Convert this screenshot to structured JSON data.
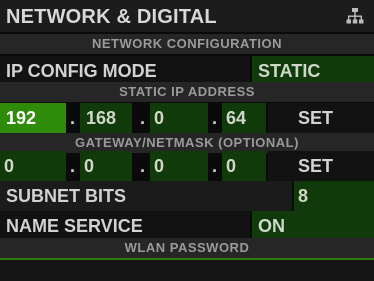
{
  "header": {
    "title": "NETWORK & DIGITAL",
    "icon": "network-icon"
  },
  "sections": {
    "network_config": "NETWORK CONFIGURATION",
    "static_ip": "STATIC IP ADDRESS",
    "gateway": "GATEWAY/NETMASK (OPTIONAL)",
    "wlan": "WLAN PASSWORD"
  },
  "ip_config": {
    "label": "IP CONFIG MODE",
    "value": "STATIC"
  },
  "static_ip": {
    "octets": [
      "192",
      "168",
      "0",
      "64"
    ],
    "dot": ".",
    "set_label": "SET"
  },
  "gateway": {
    "octets": [
      "0",
      "0",
      "0",
      "0"
    ],
    "dot": ".",
    "set_label": "SET"
  },
  "subnet": {
    "label": "SUBNET BITS",
    "value": "8"
  },
  "name_service": {
    "label": "NAME SERVICE",
    "value": "ON"
  },
  "wlan": {
    "password": ""
  },
  "colors": {
    "accent": "#2f8c0a",
    "field": "#103a0a",
    "section": "#262626"
  }
}
